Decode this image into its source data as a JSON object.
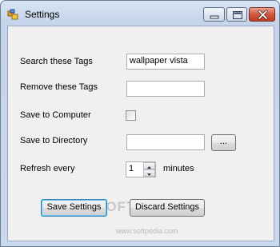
{
  "window": {
    "title": "Settings"
  },
  "form": {
    "search_tags_label": "Search these Tags",
    "search_tags_value": "wallpaper vista",
    "remove_tags_label": "Remove these Tags",
    "remove_tags_value": "",
    "save_computer_label": "Save to Computer",
    "save_computer_checked": false,
    "save_directory_label": "Save to Directory",
    "save_directory_value": "",
    "browse_label": "...",
    "refresh_label": "Refresh every",
    "refresh_value": "1",
    "refresh_unit": "minutes"
  },
  "buttons": {
    "save": "Save Settings",
    "discard": "Discard Settings"
  },
  "watermark": {
    "main": "SOFTPEDIA",
    "url": "www.softpedia.com"
  },
  "icons": {
    "app": "app-icon",
    "minimize": "minimize-icon",
    "maximize": "maximize-icon",
    "close": "close-icon",
    "spin_up": "arrow-up-icon",
    "spin_down": "arrow-down-icon"
  }
}
